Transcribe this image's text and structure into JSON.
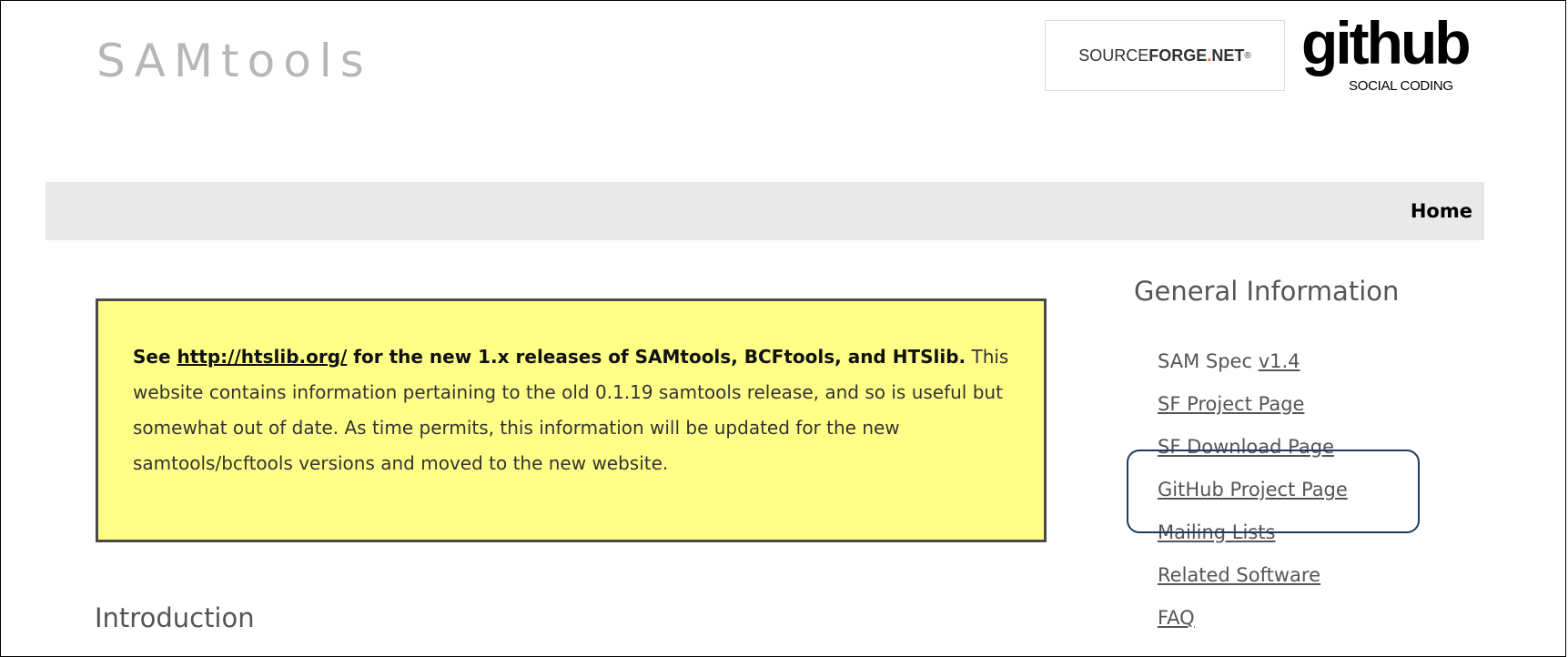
{
  "header": {
    "site_title": "SAMtools",
    "sourceforge_logo": {
      "part1": "SOURCE",
      "part2": "FORGE",
      "dot": ".",
      "part3": "NET",
      "reg": "®"
    },
    "github_logo": {
      "word": "github",
      "tagline": "SOCIAL CODING"
    }
  },
  "nav": {
    "home_label": "Home"
  },
  "notice": {
    "prefix": "See ",
    "link_text": "http://htslib.org/",
    "bold_rest": " for the new 1.x releases of SAMtools, BCFtools, and HTSlib.",
    "body": " This website contains information pertaining to the old 0.1.19 samtools release, and so is useful but somewhat out of date. As time permits, this information will be updated for the new samtools/bcftools versions and moved to the new website."
  },
  "main": {
    "intro_heading": "Introduction"
  },
  "sidebar": {
    "heading": "General Information",
    "sam_spec_label": "SAM Spec ",
    "sam_spec_version": "v1.4",
    "links": [
      "SF Project Page",
      "SF Download Page",
      "GitHub Project Page",
      "Mailing Lists",
      "Related Software",
      "FAQ"
    ]
  },
  "colors": {
    "notice_bg": "#ffff88",
    "nav_bg": "#e9e9e9",
    "highlight_border": "#1f3a5f",
    "title_gray": "#b7b7b7"
  }
}
